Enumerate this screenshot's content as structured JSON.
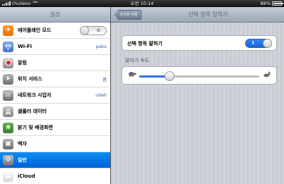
{
  "status_bar": {
    "carrier": "chulwoo",
    "time": "오전 10:14",
    "battery": "88%",
    "battery_level": 0.88
  },
  "sidebar": {
    "title": "설정",
    "items": [
      {
        "label": "에어플레인 모드",
        "icon": "airplane-icon",
        "toggle": "O",
        "toggle_state": "off"
      },
      {
        "label": "Wi-Fi",
        "icon": "wifi-icon",
        "value": "paks"
      },
      {
        "label": "알림",
        "icon": "notification-icon"
      },
      {
        "label": "위치 서비스",
        "icon": "location-icon",
        "value": "켬"
      },
      {
        "label": "네트워크 사업자",
        "icon": "carrier-icon",
        "value": "olleh"
      },
      {
        "label": "셀룰러 데이터",
        "icon": "cellular-icon"
      },
      {
        "label": "밝기 및 배경화면",
        "icon": "brightness-icon"
      },
      {
        "label": "액자",
        "icon": "picture-frame-icon"
      },
      {
        "label": "일반",
        "icon": "general-gear-icon",
        "selected": true
      },
      {
        "label": "iCloud",
        "icon": "icloud-icon"
      }
    ]
  },
  "detail": {
    "back_label": "손쉬운 사용",
    "title": "선택 항목 말하기",
    "speak_selection": {
      "label": "선택 항목 말하기",
      "toggle": "I",
      "state": "on"
    },
    "speaking_rate": {
      "label": "말하기 속도",
      "value": 0.25,
      "slow_icon": "turtle-icon",
      "fast_icon": "rabbit-icon"
    }
  },
  "colors": {
    "accent": "#1d64d8",
    "selected_row": "#0070e0",
    "nav_bar": "#a4b0bf"
  }
}
